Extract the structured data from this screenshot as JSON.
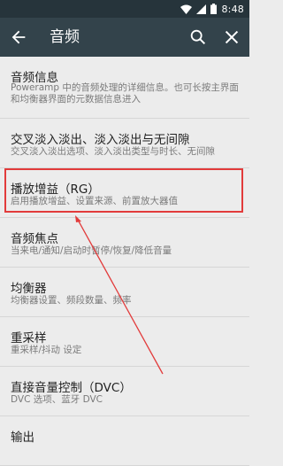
{
  "status_bar": {
    "time": "8:48"
  },
  "app_bar": {
    "title": "音频"
  },
  "items": [
    {
      "label": "音频信息",
      "summary": "Poweramp 中的音频处理的详细信息。也可长按主界面和均衡器界面的元数据信息进入"
    },
    {
      "label": "交叉淡入淡出、淡入淡出与无间隙",
      "summary": "交叉淡入淡出选项、淡入淡出类型与时长、无间隙"
    },
    {
      "label": "播放增益（RG）",
      "summary": "启用播放增益、设置来源、前置放大器值"
    },
    {
      "label": "音频焦点",
      "summary": "当来电/通知/启动时暂停/恢复/降低音量"
    },
    {
      "label": "均衡器",
      "summary": "均衡器设置、频段数量、频率"
    },
    {
      "label": "重采样",
      "summary": "重采样/抖动 设定"
    },
    {
      "label": "直接音量控制（DVC）",
      "summary": "DVC 选项、蓝牙 DVC"
    },
    {
      "label": "输出",
      "summary": ""
    }
  ],
  "colors": {
    "status_bar": "#26343b",
    "app_bar": "#33434b",
    "highlight": "#e23b3b",
    "background": "#ececec"
  },
  "icons": [
    "wifi-icon",
    "signal-icon",
    "battery-icon",
    "back-arrow-icon",
    "search-icon",
    "close-icon"
  ]
}
